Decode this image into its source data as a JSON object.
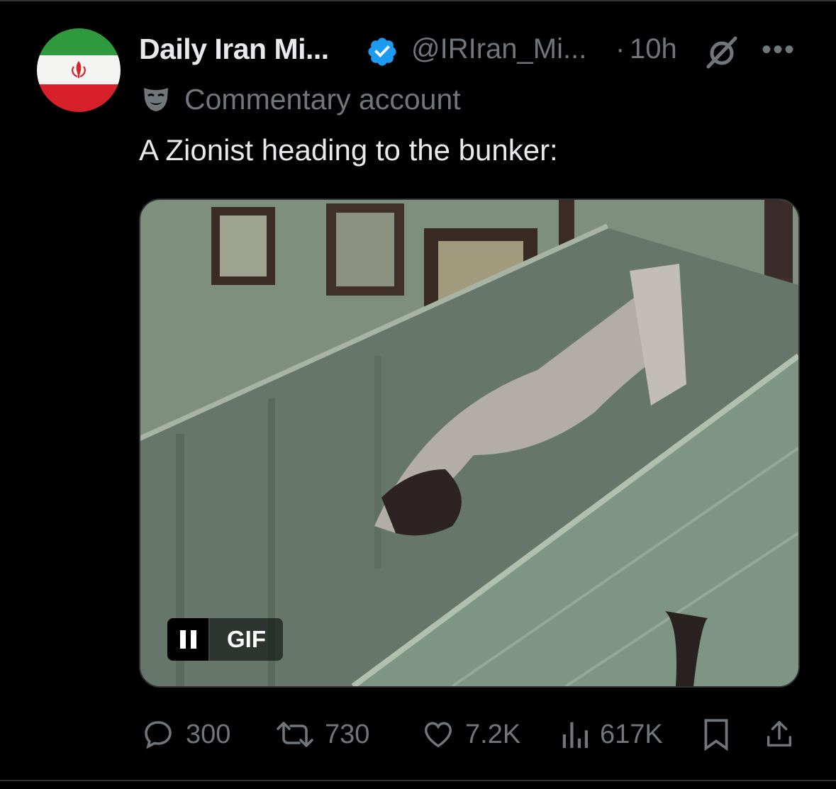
{
  "post": {
    "display_name": "Daily Iran Mi...",
    "handle": "@IRIran_Mi...",
    "separator": "·",
    "time": "10h",
    "more": "•••",
    "account_label": "Commentary account",
    "text": "A Zionist heading to the bunker:",
    "media": {
      "type": "GIF",
      "gif_label": "GIF",
      "playing": true
    },
    "stats": {
      "replies": "300",
      "reposts": "730",
      "likes": "7.2K",
      "views": "617K"
    }
  },
  "icons": {
    "avatar": "iran-flag-avatar",
    "verified": "verified-badge-icon",
    "grok": "grok-icon",
    "more": "more-options-icon",
    "label": "theater-mask-icon",
    "reply": "reply-icon",
    "repost": "repost-icon",
    "like": "heart-icon",
    "views": "views-chart-icon",
    "bookmark": "bookmark-icon",
    "share": "share-icon"
  },
  "colors": {
    "background": "#000000",
    "text": "#e7e9ea",
    "muted": "#71767b",
    "verified": "#1d9bf0"
  }
}
